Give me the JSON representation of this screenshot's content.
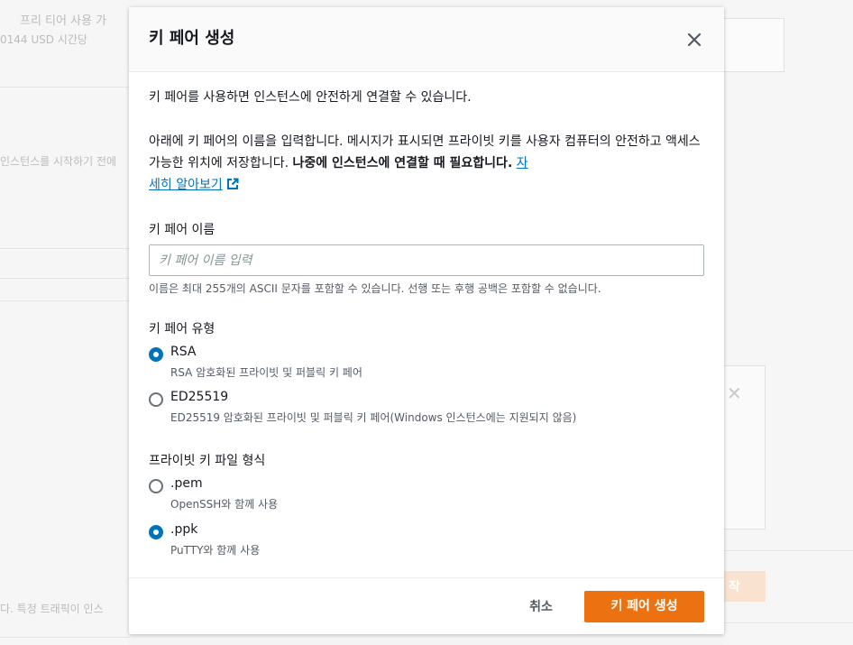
{
  "background": {
    "left_texts": [
      "프리 티어 사용 가",
      "0144 USD 시간당",
      "인스턴스를 시작하기 전에",
      "다. 특정 트래픽이 인스"
    ],
    "right_button_label": "작"
  },
  "modal": {
    "title": "키 페어 생성",
    "close_icon": "close-icon",
    "intro": "키 페어를 사용하면 인스턴스에 안전하게 연결할 수 있습니다.",
    "description": {
      "text": "아래에 키 페어의 이름을 입력합니다. 메시지가 표시되면 프라이빗 키를 사용자 컴퓨터의 안전하고 액세스 가능한 위치에 저장합니다. ",
      "bold": "나중에 인스턴스에 연결할 때 필요합니다.",
      "link_part1": "자",
      "link_part2": "세히 알아보기"
    },
    "name_field": {
      "label": "키 페어 이름",
      "placeholder": "키 페어 이름 입력",
      "value": "",
      "hint": "이름은 최대 255개의 ASCII 문자를 포함할 수 있습니다. 선행 또는 후행 공백은 포함할 수 없습니다."
    },
    "key_type": {
      "label": "키 페어 유형",
      "options": [
        {
          "title": "RSA",
          "description": "RSA 암호화된 프라이빗 및 퍼블릭 키 페어",
          "checked": true
        },
        {
          "title": "ED25519",
          "description": "ED25519 암호화된 프라이빗 및 퍼블릭 키 페어(Windows 인스턴스에는 지원되지 않음)",
          "checked": false
        }
      ]
    },
    "file_format": {
      "label": "프라이빗 키 파일 형식",
      "options": [
        {
          "title": ".pem",
          "description": "OpenSSH와 함께 사용",
          "checked": false
        },
        {
          "title": ".ppk",
          "description": "PuTTY와 함께 사용",
          "checked": true
        }
      ]
    },
    "footer": {
      "cancel_label": "취소",
      "create_label": "키 페어 생성"
    }
  },
  "colors": {
    "primary": "#ec7211",
    "link": "#0073bb",
    "radio_checked": "#0073bb"
  }
}
